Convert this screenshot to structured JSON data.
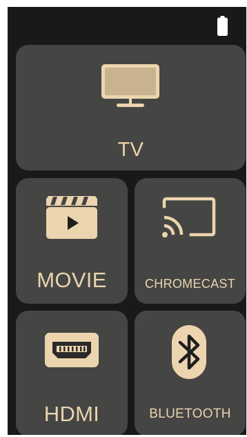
{
  "colors": {
    "background": "#191919",
    "tile": "#454544",
    "accent": "#ead4ad",
    "icon_fill": "#ecd5ae",
    "battery": "#ffffff"
  },
  "status_bar": {
    "battery_icon": "battery-full-icon"
  },
  "tiles": [
    {
      "label": "TV",
      "icon": "tv-icon"
    },
    {
      "label": "MOVIE",
      "icon": "clapperboard-play-icon"
    },
    {
      "label": "CHROMECAST",
      "icon": "cast-icon"
    },
    {
      "label": "HDMI",
      "icon": "hdmi-port-icon"
    },
    {
      "label": "BLUETOOTH",
      "icon": "bluetooth-icon"
    }
  ]
}
